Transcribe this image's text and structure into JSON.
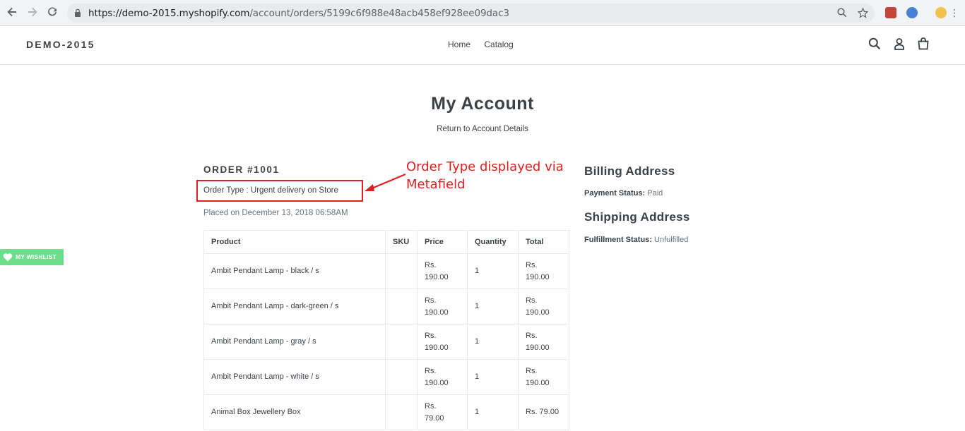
{
  "browser": {
    "url_host": "https://demo-2015.myshopify.com",
    "url_path": "/account/orders/5199c6f988e48acb458ef928ee09dac3"
  },
  "header": {
    "logo": "DEMO-2015",
    "nav": [
      "Home",
      "Catalog"
    ]
  },
  "page": {
    "title": "My Account",
    "return_link": "Return to Account Details"
  },
  "order": {
    "title": "ORDER #1001",
    "order_type": "Order Type : Urgent delivery on Store",
    "placed": "Placed on December 13, 2018 06:58AM"
  },
  "annotation": {
    "line1": "Order Type displayed via",
    "line2": "Metafield"
  },
  "table": {
    "headers": [
      "Product",
      "SKU",
      "Price",
      "Quantity",
      "Total"
    ],
    "rows": [
      {
        "product": "Ambit Pendant Lamp - black / s",
        "sku": "",
        "price_1": "Rs.",
        "price_2": "190.00",
        "qty": "1",
        "total_1": "Rs.",
        "total_2": "190.00"
      },
      {
        "product": "Ambit Pendant Lamp - dark-green / s",
        "sku": "",
        "price_1": "Rs.",
        "price_2": "190.00",
        "qty": "1",
        "total_1": "Rs.",
        "total_2": "190.00"
      },
      {
        "product": "Ambit Pendant Lamp - gray / s",
        "sku": "",
        "price_1": "Rs.",
        "price_2": "190.00",
        "qty": "1",
        "total_1": "Rs.",
        "total_2": "190.00"
      },
      {
        "product": "Ambit Pendant Lamp - white / s",
        "sku": "",
        "price_1": "Rs.",
        "price_2": "190.00",
        "qty": "1",
        "total_1": "Rs.",
        "total_2": "190.00"
      },
      {
        "product": "Animal Box Jewellery Box",
        "sku": "",
        "price_1": "Rs.",
        "price_2": "79.00",
        "qty": "1",
        "total_1": "Rs. 79.00",
        "total_2": ""
      }
    ]
  },
  "billing": {
    "title": "Billing Address",
    "payment_label": "Payment Status:",
    "payment_value": "Paid"
  },
  "shipping": {
    "title": "Shipping Address",
    "fulfillment_label": "Fulfillment Status:",
    "fulfillment_value": "Unfulfilled"
  },
  "wishlist": {
    "label": "MY WISHLIST"
  },
  "colors": {
    "annotation": "#e02020",
    "wishlist": "#6cdf8a",
    "text": "#3d4246"
  }
}
